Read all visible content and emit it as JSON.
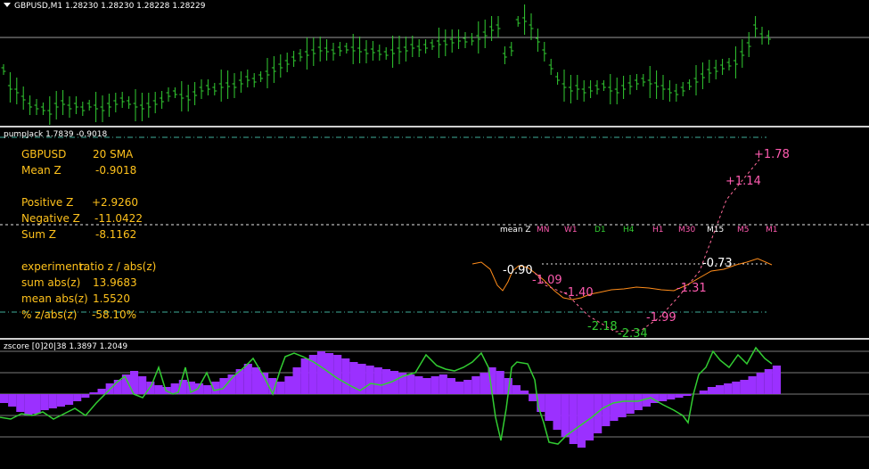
{
  "price_pane": {
    "title": "GBPUSD,M1  1.28230 1.28230 1.28228 1.28229",
    "bar_color": "#32cd32"
  },
  "pump_pane": {
    "title": "pumpJack 1.7839 -0.9018",
    "text_color": "#ffc21c",
    "rows": [
      {
        "label": "GBPUSD",
        "value": "20 SMA"
      },
      {
        "label": "Mean Z",
        "value": "-0.9018"
      },
      {
        "label": "Positive Z",
        "value": "+2.9260"
      },
      {
        "label": "Negative Z",
        "value": "-11.0422"
      },
      {
        "label": "Sum Z",
        "value": "-8.1162"
      },
      {
        "label": "experiment:",
        "value": "ratio z / abs(z)"
      },
      {
        "label": "sum abs(z)",
        "value": "13.9683"
      },
      {
        "label": "mean abs(z)",
        "value": "1.5520"
      },
      {
        "label": "% z/abs(z)",
        "value": "-58.10%"
      }
    ],
    "timeframes": [
      {
        "label": "mean Z",
        "color": "#ffffff"
      },
      {
        "label": "MN",
        "color": "#ff5bb0"
      },
      {
        "label": "W1",
        "color": "#ff5bb0"
      },
      {
        "label": "D1",
        "color": "#32cd32"
      },
      {
        "label": "H4",
        "color": "#32cd32"
      },
      {
        "label": "H1",
        "color": "#ff5bb0"
      },
      {
        "label": "M30",
        "color": "#ff5bb0"
      },
      {
        "label": "M15",
        "color": "#ffffff"
      },
      {
        "label": "M5",
        "color": "#ff5bb0"
      },
      {
        "label": "M1",
        "color": "#ff5bb0"
      }
    ],
    "z_labels": [
      {
        "text": "-0.90",
        "color": "#ffffff"
      },
      {
        "text": "-1.09",
        "color": "#ff5bb0"
      },
      {
        "text": "-1.40",
        "color": "#ff5bb0"
      },
      {
        "text": "-2.18",
        "color": "#32cd32"
      },
      {
        "text": "-2.34",
        "color": "#32cd32"
      },
      {
        "text": "-1.99",
        "color": "#ff5bb0"
      },
      {
        "text": "-1.31",
        "color": "#ff5bb0"
      },
      {
        "text": "-0.73",
        "color": "#ffffff"
      },
      {
        "text": "+1.14",
        "color": "#ff5bb0"
      },
      {
        "text": "+1.78",
        "color": "#ff5bb0"
      }
    ]
  },
  "zscore_pane": {
    "title": "zscore [0]20|38 1.3897 1.2049",
    "hist_color": "#9b30ff",
    "line_color": "#32cd32"
  }
}
